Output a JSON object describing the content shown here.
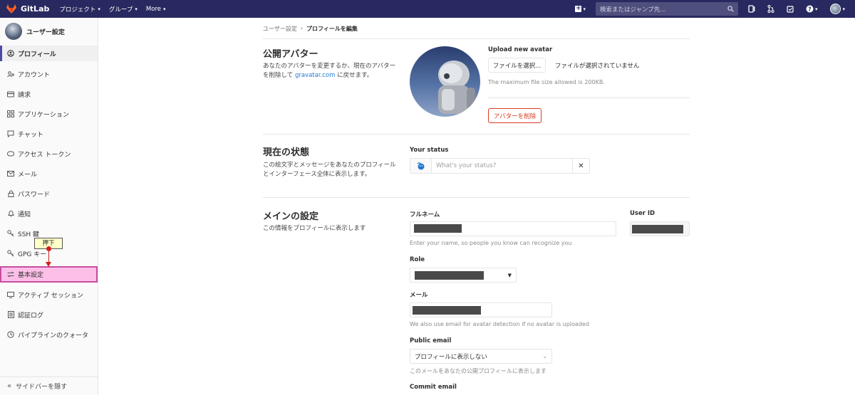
{
  "topbar": {
    "brand": "GitLab",
    "nav": [
      {
        "label": "プロジェクト"
      },
      {
        "label": "グループ"
      },
      {
        "label": "More"
      }
    ],
    "search_placeholder": "検索またはジャンプ先..."
  },
  "sidebar": {
    "title": "ユーザー設定",
    "items": [
      {
        "label": "プロフィール",
        "icon": "profile-icon"
      },
      {
        "label": "アカウント",
        "icon": "account-icon"
      },
      {
        "label": "請求",
        "icon": "credit-card-icon"
      },
      {
        "label": "アプリケーション",
        "icon": "applications-icon"
      },
      {
        "label": "チャット",
        "icon": "comment-icon"
      },
      {
        "label": "アクセス トークン",
        "icon": "token-icon"
      },
      {
        "label": "メール",
        "icon": "mail-icon"
      },
      {
        "label": "パスワード",
        "icon": "lock-icon"
      },
      {
        "label": "通知",
        "icon": "bell-icon"
      },
      {
        "label": "SSH 鍵",
        "icon": "key-icon"
      },
      {
        "label": "GPG キー",
        "icon": "key-icon"
      },
      {
        "label": "基本設定",
        "icon": "preferences-icon"
      },
      {
        "label": "アクティブ セッション",
        "icon": "monitor-icon"
      },
      {
        "label": "認証ログ",
        "icon": "log-icon"
      },
      {
        "label": "パイプラインのクォータ",
        "icon": "quota-icon"
      }
    ],
    "collapse_label": "サイドバーを隠す"
  },
  "annotation": {
    "text": "押下"
  },
  "breadcrumb": {
    "parent": "ユーザー設定",
    "current": "プロフィールを編集"
  },
  "avatar_section": {
    "title": "公開アバター",
    "desc_1": "あなたのアバターを変更するか、現在のアバターを削除して",
    "desc_link": "gravatar.com",
    "desc_2": " に戻せます。",
    "upload_label": "Upload new avatar",
    "choose_file": "ファイルを選択...",
    "no_file": "ファイルが選択されていません",
    "max_size": "The maximum file size allowed is 200KB.",
    "remove_button": "アバターを削除"
  },
  "status_section": {
    "title": "現在の状態",
    "desc": "この絵文字とメッセージをあなたのプロフィールとインターフェース全体に表示します。",
    "label": "Your status",
    "placeholder": "What's your status?",
    "clear": "✕"
  },
  "main_section": {
    "title": "メインの設定",
    "desc": "この情報をプロフィールに表示します",
    "fullname_label": "フルネーム",
    "fullname_help": "Enter your name, so people you know can recognize you",
    "userid_label": "User ID",
    "role_label": "Role",
    "email_label": "メール",
    "email_help": "We also use email for avatar detection if no avatar is uploaded",
    "public_email_label": "Public email",
    "public_email_value": "プロフィールに表示しない",
    "public_email_help": "このメールをあなたの公開プロフィールに表示します",
    "commit_email_label": "Commit email"
  }
}
